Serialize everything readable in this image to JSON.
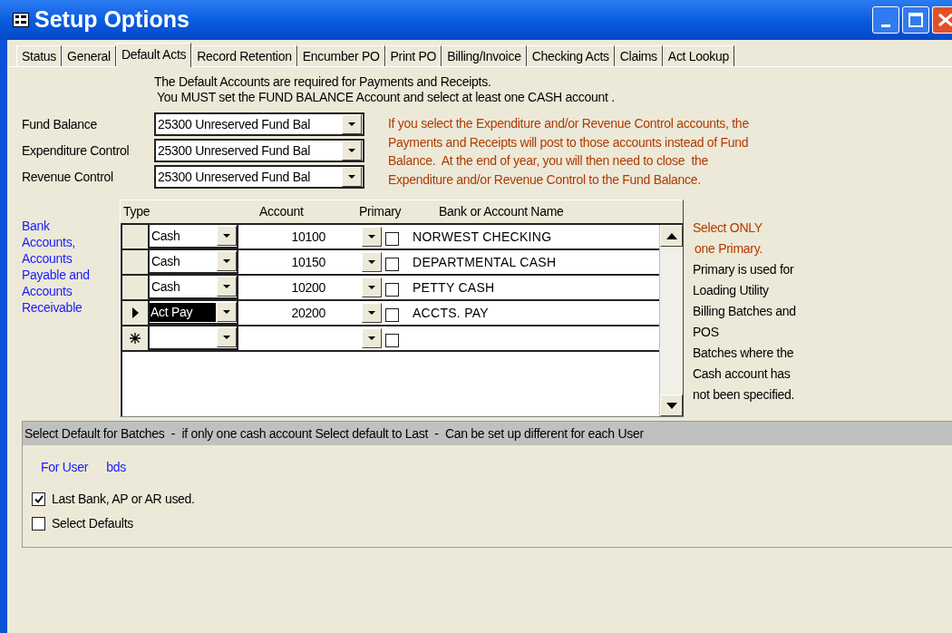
{
  "window": {
    "title": "Setup Options"
  },
  "tabs": [
    {
      "label": "Status",
      "selected": false
    },
    {
      "label": "General",
      "selected": false
    },
    {
      "label": "Default Acts",
      "selected": true
    },
    {
      "label": "Record Retention",
      "selected": false
    },
    {
      "label": "Encumber PO",
      "selected": false
    },
    {
      "label": "Print PO",
      "selected": false
    },
    {
      "label": "Billing/Invoice",
      "selected": false
    },
    {
      "label": "Checking Acts",
      "selected": false
    },
    {
      "label": "Claims",
      "selected": false
    },
    {
      "label": "Act Lookup",
      "selected": false
    }
  ],
  "intro": [
    "The Default Accounts are required for Payments and Receipts.",
    "You MUST set the FUND BALANCE Account and select at least one CASH account ."
  ],
  "control_accounts": [
    {
      "label": "Fund Balance",
      "value": "25300 Unreserved Fund Bal"
    },
    {
      "label": "Expenditure Control",
      "value": "25300 Unreserved Fund Bal"
    },
    {
      "label": "Revenue Control",
      "value": "25300 Unreserved Fund Bal"
    }
  ],
  "control_note": [
    "If you select the Expenditure and/or Revenue Control accounts, the",
    "Payments and Receipts will post to those accounts instead of Fund",
    "Balance.  At the end of year, you will then need to close  the",
    "Expenditure and/or Revenue Control to the Fund Balance."
  ],
  "grid_label": [
    "Bank",
    "Accounts,",
    "Accounts",
    "Payable and",
    "Accounts",
    "Receivable"
  ],
  "grid": {
    "columns": [
      "Type",
      "Account",
      "Primary",
      "Bank or Account Name"
    ],
    "rows": [
      {
        "kind": "record",
        "type": "Cash",
        "account": "10100",
        "primary": false,
        "name": "NORWEST CHECKING",
        "selected": false
      },
      {
        "kind": "record",
        "type": "Cash",
        "account": "10150",
        "primary": false,
        "name": "DEPARTMENTAL CASH",
        "selected": false
      },
      {
        "kind": "record",
        "type": "Cash",
        "account": "10200",
        "primary": false,
        "name": "PETTY CASH",
        "selected": false
      },
      {
        "kind": "record",
        "type": "Act Pay",
        "account": "20200",
        "primary": false,
        "name": "ACCTS. PAY",
        "selected": true
      },
      {
        "kind": "new",
        "primary": false,
        "selected": false
      }
    ]
  },
  "primary_warning": [
    "Select ONLY",
    "one Primary."
  ],
  "primary_help": [
    "Primary is used for",
    "Loading Utility",
    "Billing Batches and",
    "POS",
    "Batches where the",
    "Cash account has",
    "not been specified."
  ],
  "batches": {
    "title": "Select Default for Batches  -  if only one cash account Select default to Last  -  Can be set up different for each User",
    "user_label": "For User",
    "user": "bds",
    "options": [
      {
        "label": "Last Bank, AP or AR used.",
        "checked": true
      },
      {
        "label": "Select Defaults",
        "checked": false
      }
    ]
  }
}
